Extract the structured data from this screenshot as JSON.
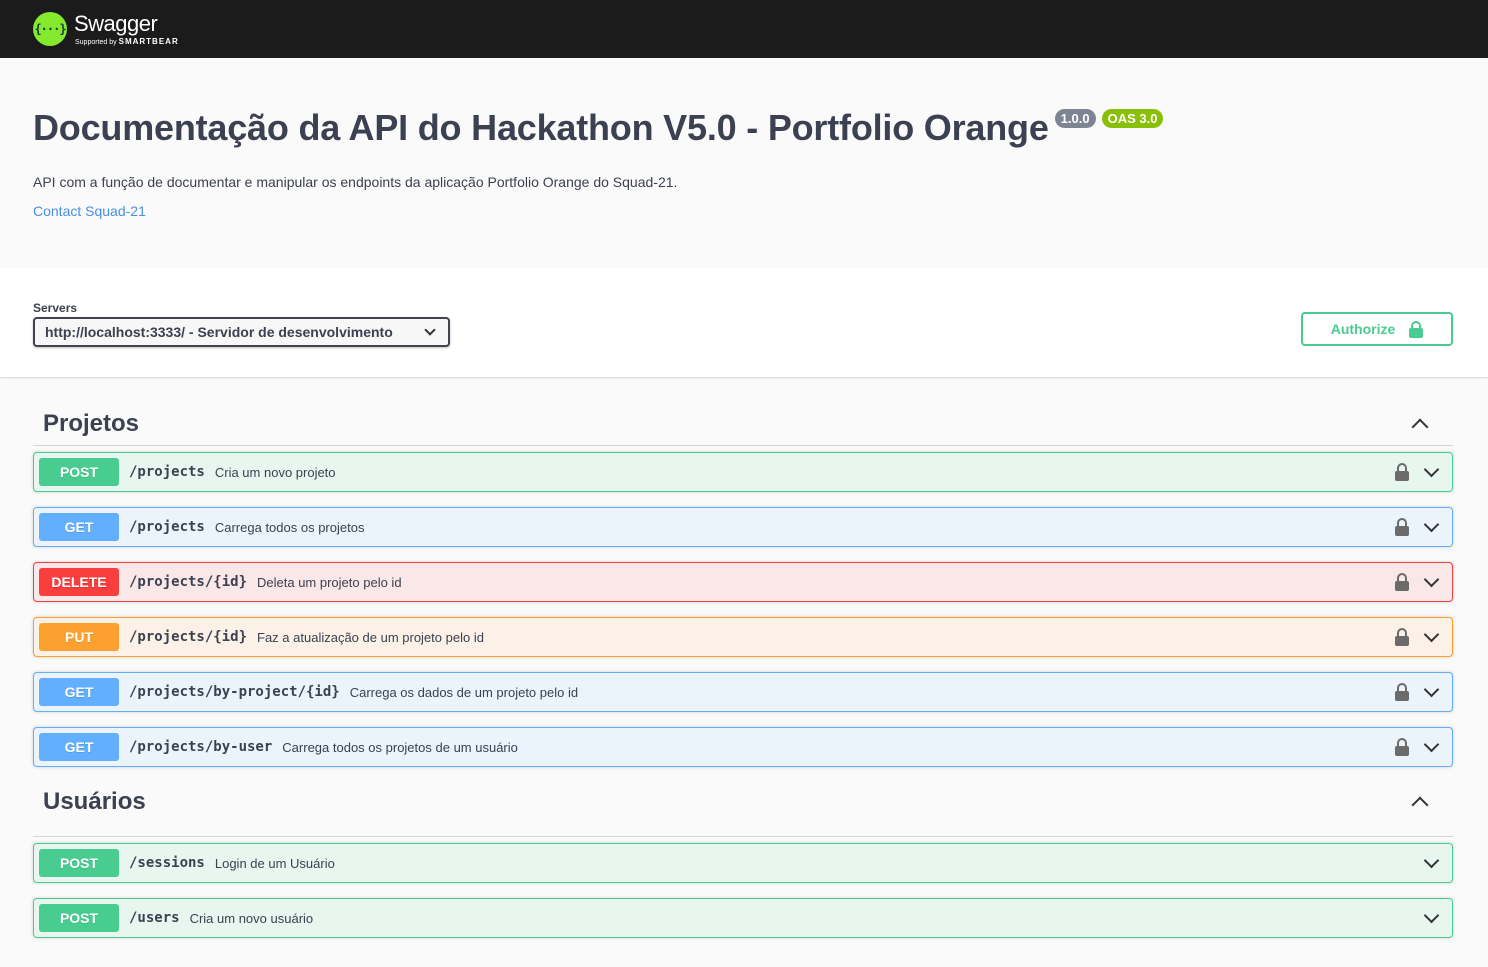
{
  "topbar": {
    "logo_mark": "{···}",
    "logo_name": "Swagger",
    "logo_sub_prefix": "Supported by",
    "logo_sub_brand": "SMARTBEAR"
  },
  "info": {
    "title": "Documentação da API do Hackathon V5.0 - Portfolio Orange",
    "version": "1.0.0",
    "oas": "OAS 3.0",
    "description": "API com a função de documentar e manipular os endpoints da aplicação Portfolio Orange do Squad-21.",
    "contact": "Contact Squad-21"
  },
  "servers": {
    "label": "Servers",
    "selected": "http://localhost:3333/ - Servidor de desenvolvimento"
  },
  "authorize": {
    "label": "Authorize"
  },
  "colors": {
    "post": "#49cc90",
    "get": "#61affe",
    "delete": "#f93e3e",
    "put": "#fca130"
  },
  "tags": [
    {
      "name": "Projetos",
      "operations": [
        {
          "method": "POST",
          "path": "/projects",
          "summary": "Cria um novo projeto",
          "locked": true
        },
        {
          "method": "GET",
          "path": "/projects",
          "summary": "Carrega todos os projetos",
          "locked": true
        },
        {
          "method": "DELETE",
          "path": "/projects/{id}",
          "summary": "Deleta um projeto pelo id",
          "locked": true
        },
        {
          "method": "PUT",
          "path": "/projects/{id}",
          "summary": "Faz a atualização de um projeto pelo id",
          "locked": true
        },
        {
          "method": "GET",
          "path": "/projects/by-project/{id}",
          "summary": "Carrega os dados de um projeto pelo id",
          "locked": true
        },
        {
          "method": "GET",
          "path": "/projects/by-user",
          "summary": "Carrega todos os projetos de um usuário",
          "locked": true
        }
      ]
    },
    {
      "name": "Usuários",
      "operations": [
        {
          "method": "POST",
          "path": "/sessions",
          "summary": "Login de um Usuário",
          "locked": false
        },
        {
          "method": "POST",
          "path": "/users",
          "summary": "Cria um novo usuário",
          "locked": false
        }
      ]
    }
  ]
}
